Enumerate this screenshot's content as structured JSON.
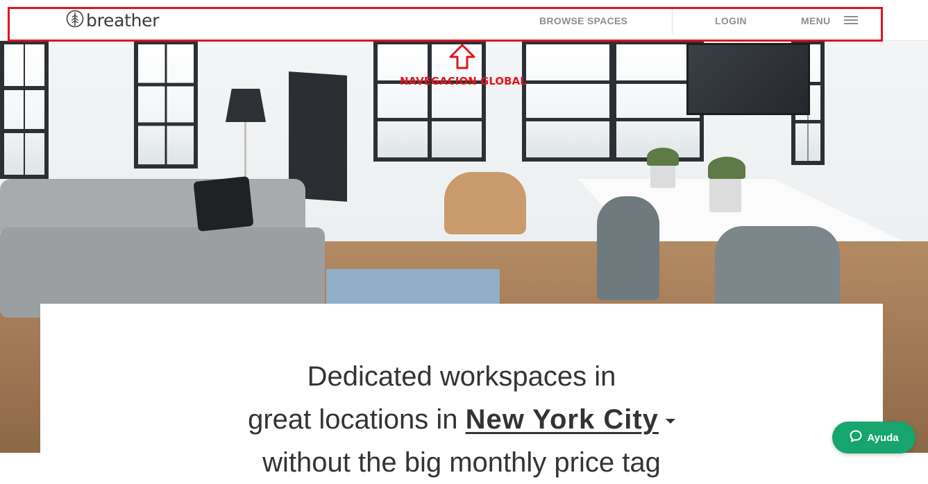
{
  "header": {
    "logo_text": "breather",
    "nav": {
      "browse_spaces": "BROWSE SPACES",
      "login": "LOGIN",
      "menu": "MENU"
    }
  },
  "annotation": {
    "label": "NAVEGACION GLOBAL",
    "color": "#e0141e"
  },
  "hero": {
    "headline_line1": "Dedicated workspaces in",
    "headline_line2_prefix": "great locations in",
    "city": "New York City",
    "headline_line3_partial": "without the big monthly price tag"
  },
  "help_button": {
    "label": "Ayuda",
    "color": "#16a56d"
  },
  "icons": [
    "breather-logo-icon",
    "hamburger-menu-icon",
    "chevron-down-icon",
    "chat-bubble-icon",
    "up-arrow-icon"
  ]
}
